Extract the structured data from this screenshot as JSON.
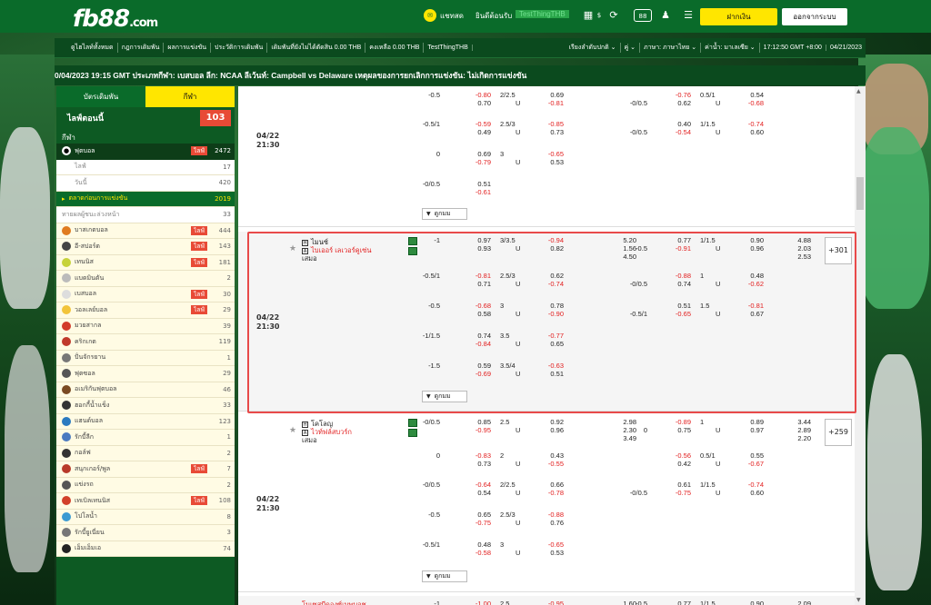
{
  "header": {
    "logo": "fb88",
    "logo_suffix": ".com",
    "chat": "แชทสด",
    "welcome": "ยินดีต้อนรับ",
    "username": "TestThingTHB",
    "deposit": "ฝากเงิน",
    "logout": "ออกจากระบบ"
  },
  "nav": {
    "items": [
      "ดูไฮไลท์ทั้งหมด",
      "กฎการเดิมพัน",
      "ผลการแข่งขัน",
      "ประวัติการเดิมพัน",
      "เดิมพันที่ยังไม่ได้ตัดสิน 0.00 THB",
      "คงเหลือ 0.00 THB",
      "TestThingTHB"
    ],
    "sort": "เรียงลำดับปกติ",
    "odds_type": "คู่",
    "language": "ภาษา: ภาษาไทย",
    "odds_format": "ค่าน้ำ: มาเลเซีย",
    "clock": "17:12:50 GMT +8:00",
    "date": "04/21/2023"
  },
  "ticker": "0/04/2023 19:15 GMT ประเภทกีฬา: เบสบอล ลีก: NCAA ลีเว้นท์: Campbell vs Delaware เหตุผลของการยกเลิกการแข่งขัน: ไม่เกิดการแข่งขัน",
  "sidebar": {
    "tab_bet": "บัตรเดิมพัน",
    "tab_sport": "กีฬา",
    "live_now": "ไลฟ์ตอนนี้",
    "live_count": "103",
    "section": "กีฬา",
    "football": {
      "label": "ฟุตบอล",
      "live": "ไลฟ์",
      "count": "2472"
    },
    "live_sub": {
      "label": "ไลฟ์",
      "count": "17"
    },
    "today_sub": {
      "label": "วันนี้",
      "count": "420"
    },
    "early": {
      "label": "ตลาดก่อนการแข่งขัน",
      "count": "2019"
    },
    "outright": {
      "label": "ทายผลผู้ชนะล่วงหน้า",
      "count": "33"
    },
    "sports": [
      {
        "label": "บาสเกตบอล",
        "live": "ไลฟ์",
        "count": "444",
        "color": "#e07b1f"
      },
      {
        "label": "อี-สปอร์ต",
        "live": "ไลฟ์",
        "count": "143",
        "color": "#444444"
      },
      {
        "label": "เทนนิส",
        "live": "ไลฟ์",
        "count": "181",
        "color": "#c6d23a"
      },
      {
        "label": "แบดมินตัน",
        "live": "",
        "count": "2",
        "color": "#bbbbbb"
      },
      {
        "label": "เบสบอล",
        "live": "ไลฟ์",
        "count": "30",
        "color": "#dddddd"
      },
      {
        "label": "วอลเลย์บอล",
        "live": "ไลฟ์",
        "count": "29",
        "color": "#f2c43a"
      },
      {
        "label": "มวยสากล",
        "live": "",
        "count": "39",
        "color": "#d23a2a"
      },
      {
        "label": "คริกเกต",
        "live": "",
        "count": "119",
        "color": "#c0392b"
      },
      {
        "label": "ปั่นจักรยาน",
        "live": "",
        "count": "1",
        "color": "#777777"
      },
      {
        "label": "ฟุตซอล",
        "live": "",
        "count": "29",
        "color": "#555555"
      },
      {
        "label": "อเมริกันฟุตบอล",
        "live": "",
        "count": "46",
        "color": "#7a4a22"
      },
      {
        "label": "ฮอกกี้น้ำแข็ง",
        "live": "",
        "count": "33",
        "color": "#333333"
      },
      {
        "label": "แฮนด์บอล",
        "live": "",
        "count": "123",
        "color": "#2a7ac0"
      },
      {
        "label": "รักบี้ลีก",
        "live": "",
        "count": "1",
        "color": "#4a7ac0"
      },
      {
        "label": "กอล์ฟ",
        "live": "",
        "count": "2",
        "color": "#333333"
      },
      {
        "label": "สนุกเกอร์/พูล",
        "live": "ไลฟ์",
        "count": "7",
        "color": "#b83a2a"
      },
      {
        "label": "แข่งรถ",
        "live": "",
        "count": "2",
        "color": "#555555"
      },
      {
        "label": "เทเบิลเทนนิส",
        "live": "ไลฟ์",
        "count": "108",
        "color": "#d2402a"
      },
      {
        "label": "โปโลน้ำ",
        "live": "",
        "count": "8",
        "color": "#3a9ad2"
      },
      {
        "label": "รักบี้ยูเนี่ยน",
        "live": "",
        "count": "3",
        "color": "#777777"
      },
      {
        "label": "เอ็มเอ็มเอ",
        "live": "",
        "count": "74",
        "color": "#222222"
      }
    ]
  },
  "table": {
    "more": "ดูกมม",
    "block1": {
      "date": "04/22",
      "time": "21:30",
      "rows": [
        {
          "hdp": "-0.5",
          "o1": "-0.80",
          "o1b": "0.70",
          "ou": "2/2.5",
          "u": "U",
          "o2": "0.69",
          "o2b": "-0.81",
          "h2": "-0/0.5",
          "h2o": "-0.76",
          "h2ob": "0.62",
          "ou2": "0.5/1",
          "u2": "U",
          "ou2o": "0.54",
          "ou2ob": "-0.68"
        },
        {
          "hdp": "-0.5/1",
          "o1": "-0.59",
          "o1b": "0.49",
          "ou": "2.5/3",
          "u": "U",
          "o2": "-0.85",
          "o2b": "0.73",
          "h2": "-0/0.5",
          "h2o": "0.40",
          "h2ob": "-0.54",
          "ou2": "1/1.5",
          "u2": "U",
          "ou2o": "-0.74",
          "ou2ob": "0.60"
        },
        {
          "hdp": "0",
          "o1": "0.69",
          "o1b": "-0.79",
          "ou": "3",
          "u": "U",
          "o2": "-0.65",
          "o2b": "0.53"
        },
        {
          "hdp": "-0/0.5",
          "o1": "0.51",
          "o1b": "-0.61"
        }
      ]
    },
    "block2": {
      "date": "04/22",
      "time": "21:30",
      "home": "ไมนซ์",
      "away": "ไบเออร์ เลเวอร์คูเซ่น",
      "draw": "เสมอ",
      "plus": "+301",
      "main": {
        "hdp": "-1",
        "o1": "0.97",
        "o1b": "0.93",
        "ou": "3/3.5",
        "u": "U",
        "o2": "-0.94",
        "o2b": "0.82",
        "x1": "5.20",
        "x2": "1.56",
        "x3": "4.50",
        "h2": "-0.5",
        "h2o": "0.77",
        "h2ob": "-0.91",
        "ou2": "1/1.5",
        "u2": "U",
        "ou2o": "0.90",
        "ou2ob": "0.96",
        "y1": "4.88",
        "y2": "2.03",
        "y3": "2.53"
      },
      "rows": [
        {
          "hdp": "-0.5/1",
          "o1": "-0.81",
          "o1b": "0.71",
          "ou": "2.5/3",
          "u": "U",
          "o2": "0.62",
          "o2b": "-0.74",
          "h2": "-0/0.5",
          "h2o": "-0.88",
          "h2ob": "0.74",
          "ou2": "1",
          "u2": "U",
          "ou2o": "0.48",
          "ou2ob": "-0.62"
        },
        {
          "hdp": "-0.5",
          "o1": "-0.68",
          "o1b": "0.58",
          "ou": "3",
          "u": "U",
          "o2": "0.78",
          "o2b": "-0.90",
          "h2": "-0.5/1",
          "h2o": "0.51",
          "h2ob": "-0.65",
          "ou2": "1.5",
          "u2": "U",
          "ou2o": "-0.81",
          "ou2ob": "0.67"
        },
        {
          "hdp": "-1/1.5",
          "o1": "0.74",
          "o1b": "-0.84",
          "ou": "3.5",
          "u": "U",
          "o2": "-0.77",
          "o2b": "0.65"
        },
        {
          "hdp": "-1.5",
          "o1": "0.59",
          "o1b": "-0.69",
          "ou": "3.5/4",
          "u": "U",
          "o2": "-0.63",
          "o2b": "0.51"
        }
      ]
    },
    "block3": {
      "date": "04/22",
      "time": "21:30",
      "home": "โคโลญ",
      "away": "ไวท์ฟล์สบวร์ก",
      "draw": "เสมอ",
      "plus": "+259",
      "main": {
        "hdp": "-0/0.5",
        "o1": "0.85",
        "o1b": "-0.95",
        "ou": "2.5",
        "u": "U",
        "o2": "0.92",
        "o2b": "0.96",
        "x1": "2.98",
        "x2": "2.30",
        "x3": "3.49",
        "h2": "0",
        "h2o": "-0.89",
        "h2ob": "0.75",
        "ou2": "1",
        "u2": "U",
        "ou2o": "0.89",
        "ou2ob": "0.97",
        "y1": "3.44",
        "y2": "2.89",
        "y3": "2.20"
      },
      "rows": [
        {
          "hdp": "0",
          "o1": "-0.83",
          "o1b": "0.73",
          "ou": "2",
          "u": "U",
          "o2": "0.43",
          "o2b": "-0.55",
          "h2": "",
          "h2o": "-0.56",
          "h2ob": "0.42",
          "ou2": "0.5/1",
          "u2": "U",
          "ou2o": "0.55",
          "ou2ob": "-0.67"
        },
        {
          "hdp": "-0/0.5",
          "o1": "-0.64",
          "o1b": "0.54",
          "ou": "2/2.5",
          "u": "U",
          "o2": "0.66",
          "o2b": "-0.78",
          "h2": "-0/0.5",
          "h2o": "0.61",
          "h2ob": "-0.75",
          "ou2": "1/1.5",
          "u2": "U",
          "ou2o": "-0.74",
          "ou2ob": "0.60"
        },
        {
          "hdp": "-0.5",
          "o1": "0.65",
          "o1b": "-0.75",
          "ou": "2.5/3",
          "u": "U",
          "o2": "-0.88",
          "o2b": "0.76"
        },
        {
          "hdp": "-0.5/1",
          "o1": "0.48",
          "o1b": "-0.58",
          "ou": "3",
          "u": "U",
          "o2": "-0.65",
          "o2b": "0.53"
        }
      ]
    },
    "block4": {
      "home": "โมเซสบีดองซ์เบพบอช",
      "hdp": "-1",
      "o1": "-1.00",
      "ou": "2.5",
      "o2": "-0.95",
      "x1": "1.60",
      "h2": "-0.5",
      "h2o": "0.77",
      "ou2": "1/1.5",
      "ou2o": "0.90",
      "y1": "2.09"
    }
  }
}
